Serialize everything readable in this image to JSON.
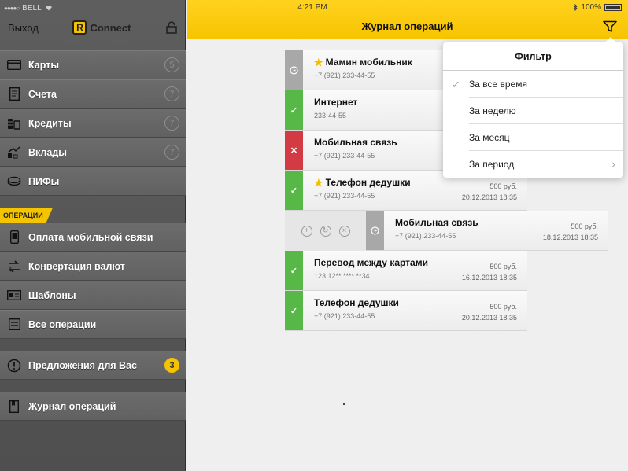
{
  "statusbar": {
    "carrier": "BELL",
    "time": "4:21 PM",
    "battery": "100%"
  },
  "sidebar": {
    "logout_label": "Выход",
    "logo_letter": "R",
    "logo_text": "Connect",
    "products": [
      {
        "label": "Карты",
        "count": "5",
        "icon": "card-icon"
      },
      {
        "label": "Счета",
        "count": "7",
        "icon": "document-icon"
      },
      {
        "label": "Кредиты",
        "count": "7",
        "icon": "coins-icon"
      },
      {
        "label": "Вклады",
        "count": "7",
        "icon": "growth-icon"
      },
      {
        "label": "ПИФы",
        "count": "",
        "icon": "funds-icon"
      }
    ],
    "operations_section_label": "ОПЕРАЦИИ",
    "operations": [
      {
        "label": "Оплата мобильной связи",
        "icon": "phone-icon"
      },
      {
        "label": "Конвертация валют",
        "icon": "exchange-icon"
      },
      {
        "label": "Шаблоны",
        "icon": "templates-icon"
      },
      {
        "label": "Все операции",
        "icon": "list-icon"
      }
    ],
    "offers": {
      "label": "Предложения для Вас",
      "count": "3"
    },
    "journal": {
      "label": "Журнал операций"
    }
  },
  "main": {
    "title": "Журнал операций",
    "operations": [
      {
        "name": "Мамин мобильник",
        "starred": true,
        "sub": "+7 (921) 233-44-55",
        "amount": "",
        "date": "",
        "status": "pending"
      },
      {
        "name": "Интернет",
        "starred": false,
        "sub": "233-44-55",
        "amount": "",
        "date": "",
        "status": "ok"
      },
      {
        "name": "Мобильная связь",
        "starred": false,
        "sub": "+7 (921) 233-44-55",
        "amount": "",
        "date": "",
        "status": "fail"
      },
      {
        "name": "Телефон дедушки",
        "starred": true,
        "sub": "+7 (921) 233-44-55",
        "amount": "500 руб.",
        "date": "20.12.2013 18:35",
        "status": "ok"
      }
    ],
    "swiped_operation": {
      "name": "Мобильная связь",
      "sub": "+7 (921) 233-44-55",
      "amount": "500 руб.",
      "date": "18.12.2013 18:35",
      "status": "pending"
    },
    "operations_after": [
      {
        "name": "Перевод между картами",
        "starred": false,
        "sub": "123 12** **** **34",
        "amount": "500 руб.",
        "date": "16.12.2013 18:35",
        "status": "ok"
      },
      {
        "name": "Телефон дедушки",
        "starred": false,
        "sub": "+7 (921) 233-44-55",
        "amount": "500 руб.",
        "date": "20.12.2013 18:35",
        "status": "ok"
      }
    ]
  },
  "filter": {
    "title": "Фильтр",
    "options": [
      "За все время",
      "За неделю",
      "За месяц",
      "За период"
    ],
    "selected_index": 0
  },
  "colors": {
    "accent": "#f7c400",
    "ok": "#58b847",
    "fail": "#d23a44",
    "pending": "#a8a8a8"
  }
}
